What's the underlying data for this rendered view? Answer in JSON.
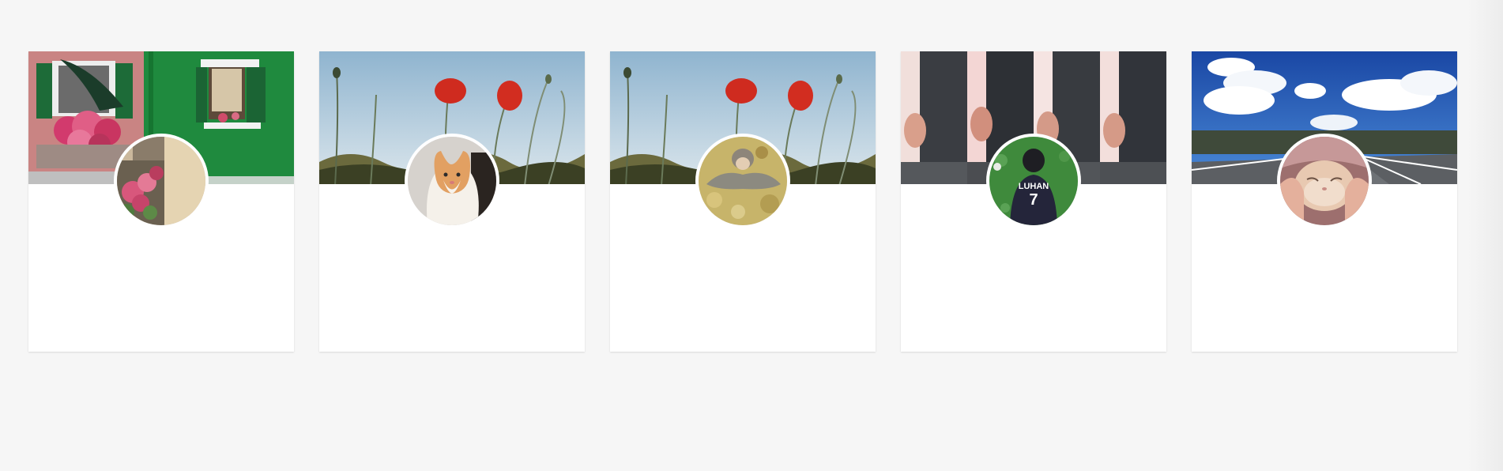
{
  "cards": [
    {
      "cover": "venice-window-flowers-photo",
      "avatar": "flower-balcony-photo"
    },
    {
      "cover": "red-poppies-sky-photo",
      "avatar": "ginger-cat-photo"
    },
    {
      "cover": "red-poppies-sky-photo",
      "avatar": "person-lying-leaves-photo"
    },
    {
      "cover": "hooded-figure-collage-photo",
      "avatar": "luhan-jersey-grass-photo",
      "avatar_text": "LUHAN 7"
    },
    {
      "cover": "blue-sky-road-photo",
      "avatar": "hands-cat-face-photo"
    }
  ],
  "colors": {
    "page_bg": "#f6f6f6",
    "card_bg": "#ffffff",
    "avatar_border": "#ffffff"
  }
}
